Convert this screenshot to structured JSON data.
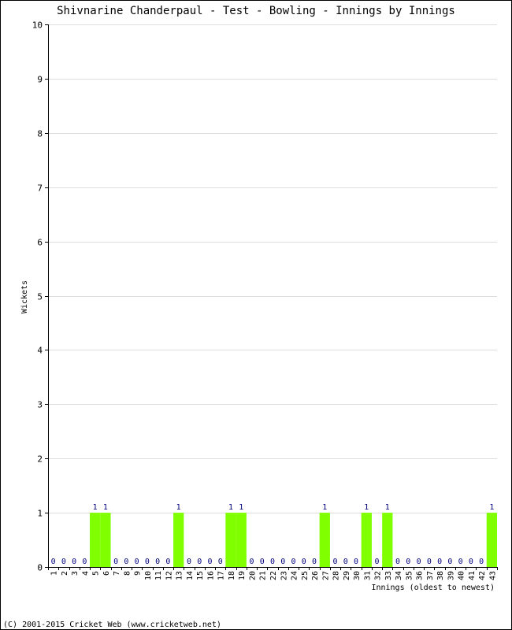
{
  "chart_data": {
    "type": "bar",
    "title": "Shivnarine Chanderpaul - Test - Bowling - Innings by Innings",
    "xlabel": "Innings (oldest to newest)",
    "ylabel": "Wickets",
    "ylim": [
      0,
      10
    ],
    "yticks": [
      0,
      1,
      2,
      3,
      4,
      5,
      6,
      7,
      8,
      9,
      10
    ],
    "grid": true,
    "categories": [
      "1",
      "2",
      "3",
      "4",
      "5",
      "6",
      "7",
      "8",
      "9",
      "10",
      "11",
      "12",
      "13",
      "14",
      "15",
      "16",
      "17",
      "18",
      "19",
      "20",
      "21",
      "22",
      "23",
      "24",
      "25",
      "26",
      "27",
      "28",
      "29",
      "30",
      "31",
      "32",
      "33",
      "34",
      "35",
      "36",
      "37",
      "38",
      "39",
      "40",
      "41",
      "42",
      "43"
    ],
    "values": [
      0,
      0,
      0,
      0,
      1,
      1,
      0,
      0,
      0,
      0,
      0,
      0,
      1,
      0,
      0,
      0,
      0,
      1,
      1,
      0,
      0,
      0,
      0,
      0,
      0,
      0,
      1,
      0,
      0,
      0,
      1,
      0,
      1,
      0,
      0,
      0,
      0,
      0,
      0,
      0,
      0,
      0,
      1
    ],
    "bar_color": "#80ff00",
    "label_color": "#000080",
    "grid_color": "#dddddd"
  },
  "footer": "(C) 2001-2015 Cricket Web (www.cricketweb.net)"
}
